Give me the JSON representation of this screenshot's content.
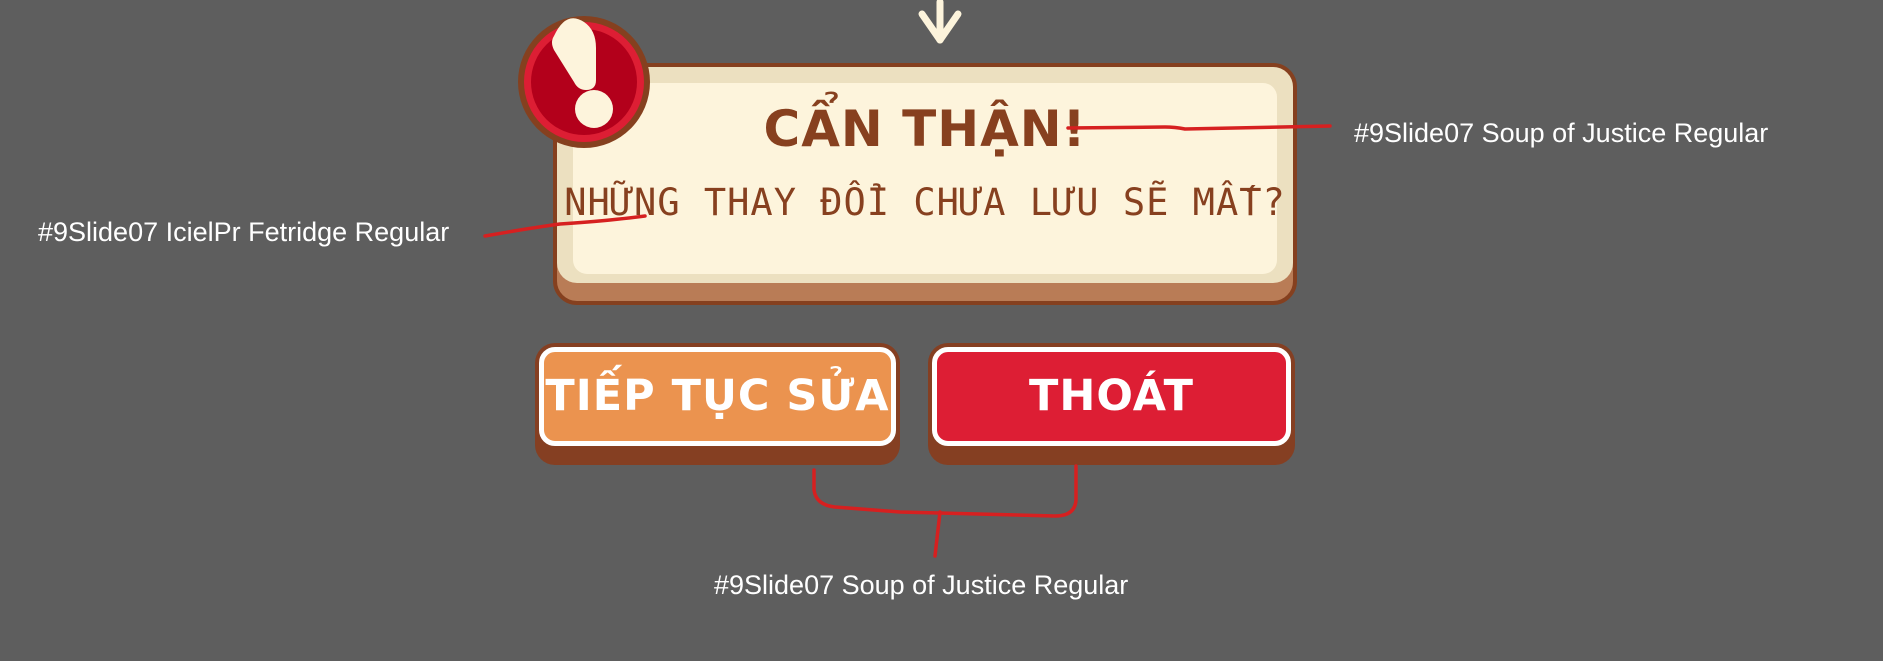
{
  "dialog": {
    "title": "CẨN THẬN!",
    "message": "NHỮNG THAY ĐỔI CHƯA LƯU SẼ MẤT?"
  },
  "buttons": {
    "continue_label": "TIẾP TỤC SỬA",
    "exit_label": "THOÁT"
  },
  "annotations": {
    "title_font": "#9Slide07 Soup of Justice Regular",
    "message_font": "#9Slide07 IcielPr Fetridge Regular",
    "buttons_font": "#9Slide07 Soup of Justice Regular"
  },
  "colors": {
    "background": "#5e5e5e",
    "dialog_border": "#85401f",
    "dialog_face": "#fdf4dc",
    "text_brown": "#87401f",
    "continue_button": "#eb934f",
    "exit_button": "#dd1e34",
    "badge_red": "#b3001b",
    "annotation_line": "#d62020"
  },
  "icons": {
    "down_arrow": "down-arrow-icon",
    "warning": "exclamation-icon"
  }
}
